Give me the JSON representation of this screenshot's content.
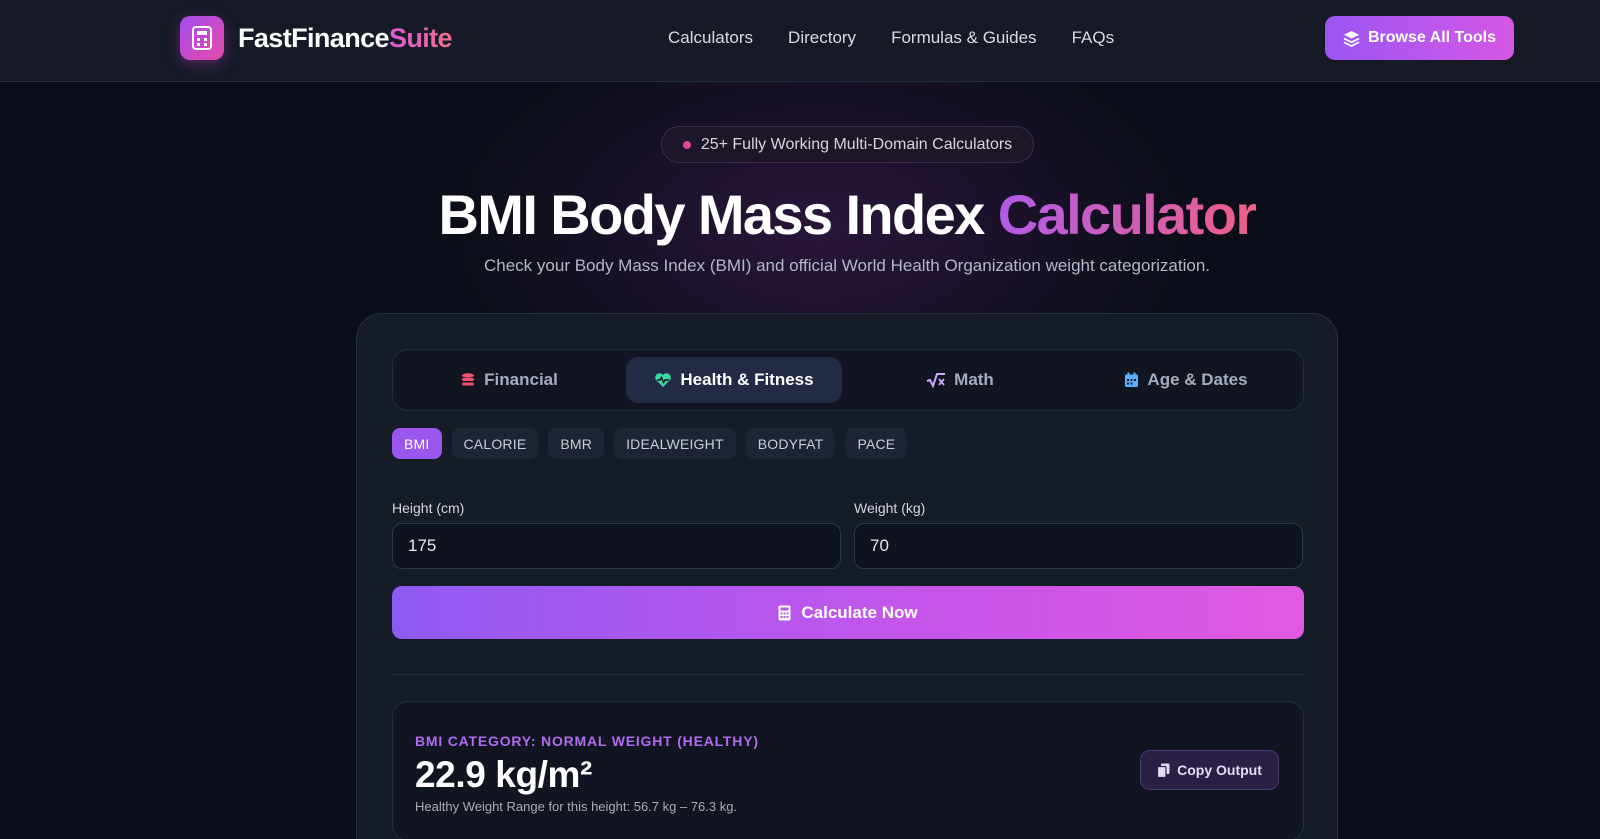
{
  "brand": {
    "name_main": "FastFinance",
    "name_accent": "Suite"
  },
  "nav": {
    "items": [
      "Calculators",
      "Directory",
      "Formulas & Guides",
      "FAQs"
    ]
  },
  "header": {
    "browse_label": "Browse All Tools"
  },
  "hero": {
    "pill_text": "25+ Fully Working Multi-Domain Calculators",
    "title_main": "BMI Body Mass Index ",
    "title_accent": "Calculator",
    "subtitle": "Check your Body Mass Index (BMI) and official World Health Organization weight categorization."
  },
  "tabs": [
    {
      "label": "Financial",
      "icon": "coins-icon",
      "color": "#f0506e"
    },
    {
      "label": "Health & Fitness",
      "icon": "heart-pulse-icon",
      "color": "#38d6a5"
    },
    {
      "label": "Math",
      "icon": "square-root-icon",
      "color": "#c9a8ff"
    },
    {
      "label": "Age & Dates",
      "icon": "calendar-icon",
      "color": "#5ab0ff"
    }
  ],
  "subtabs": [
    "BMI",
    "CALORIE",
    "BMR",
    "IDEALWEIGHT",
    "BODYFAT",
    "PACE"
  ],
  "form": {
    "height_label": "Height (cm)",
    "height_value": "175",
    "weight_label": "Weight (kg)",
    "weight_value": "70",
    "calculate_label": "Calculate Now"
  },
  "result": {
    "category": "BMI CATEGORY: NORMAL WEIGHT (HEALTHY)",
    "value": "22.9 kg/m²",
    "note": "Healthy Weight Range for this height: 56.7 kg – 76.3 kg.",
    "copy_label": "Copy Output"
  },
  "colors": {
    "accent": "#9a57ee",
    "accent_pink": "#e05ae0",
    "background": "#0b0e18"
  }
}
